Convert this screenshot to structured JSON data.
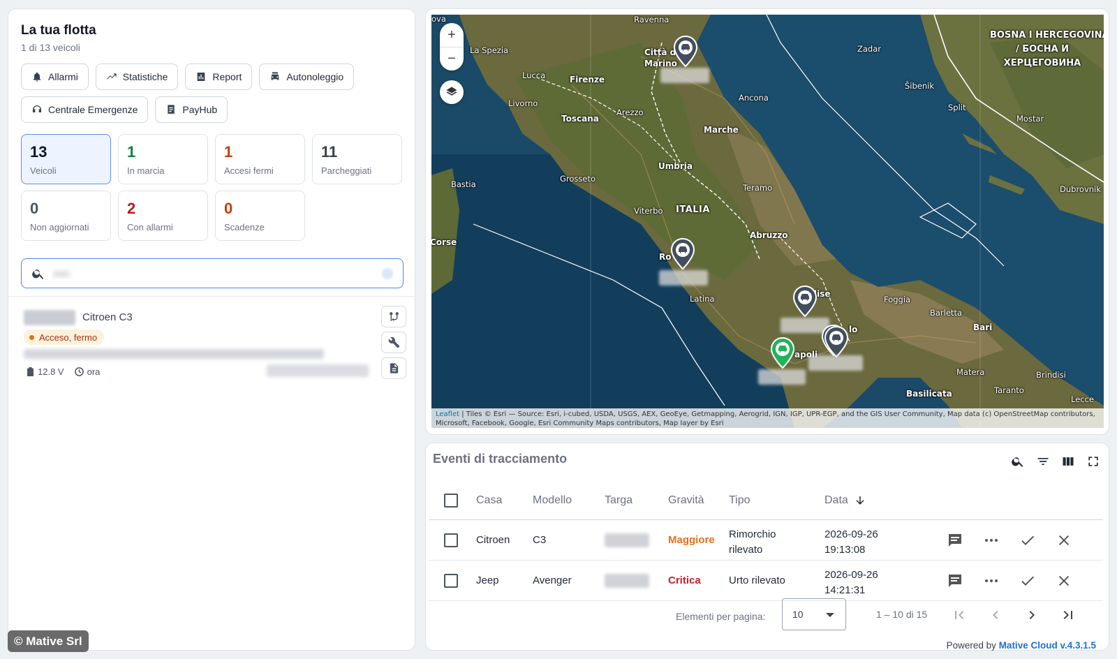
{
  "fleet": {
    "title": "La tua flotta",
    "subtitle": "1 di 13 veicoli",
    "buttons": [
      {
        "label": "Allarmi",
        "icon": "bell-icon"
      },
      {
        "label": "Statistiche",
        "icon": "trend-icon"
      },
      {
        "label": "Report",
        "icon": "report-icon"
      },
      {
        "label": "Autonoleggio",
        "icon": "car-rental-icon"
      },
      {
        "label": "Centrale Emergenze",
        "icon": "headset-icon"
      },
      {
        "label": "PayHub",
        "icon": "receipt-icon"
      }
    ],
    "stats": [
      {
        "value": "13",
        "label": "Veicoli"
      },
      {
        "value": "1",
        "label": "In marcia"
      },
      {
        "value": "1",
        "label": "Accesi fermi"
      },
      {
        "value": "11",
        "label": "Parcheggiati"
      },
      {
        "value": "0",
        "label": "Non aggiornati"
      },
      {
        "value": "2",
        "label": "Con allarmi"
      },
      {
        "value": "0",
        "label": "Scadenze"
      }
    ],
    "search": {
      "value": "•••••"
    },
    "vehicle": {
      "model": "Citroen C3",
      "status": "Acceso, fermo",
      "voltage": "12.8 V",
      "updated": "ora"
    }
  },
  "watermark": "© Mative Srl",
  "map": {
    "labels": {
      "ravenna": "Ravenna",
      "laspezia": "La Spezia",
      "lucca": "Lucca",
      "firenze": "Firenze",
      "livorno": "Livorno",
      "toscana": "Toscana",
      "arezzo": "Arezzo",
      "marche": "Marche",
      "ancona": "Ancona",
      "umbria": "Umbria",
      "grosseto": "Grosseto",
      "bastia": "Bastia",
      "teramo": "Teramo",
      "viterbo": "Viterbo",
      "italia": "ITALIA",
      "abruzzo": "Abruzzo",
      "corse": "Corse",
      "latina": "Latina",
      "foggia": "Foggia",
      "barletta": "Barletta",
      "bari": "Bari",
      "matera": "Matera",
      "brindisi": "Brindisi",
      "taranto": "Taranto",
      "basilicata": "Basilicata",
      "lecce": "Lecce",
      "zadar": "Zadar",
      "sibenik": "Šibenik",
      "split": "Split",
      "mostar": "Mostar",
      "dubrovnik": "Dubrovnik",
      "bosna1": "BOSNA I HERCEGOVINA",
      "bosna2": "/ БОСНА И",
      "bosna3": "ХЕРЦЕГОВИНА",
      "citta": "Città di",
      "marino": "Marino",
      "ova": "ova",
      "ro": "Ro",
      "lise": "lise",
      "apoli": "apoli",
      "lo": "lo"
    },
    "zoom_in": "+",
    "zoom_out": "−",
    "attribution_link": "Leaflet",
    "attribution": " | Tiles © Esri — Source: Esri, i-cubed, USDA, USGS, AEX, GeoEye, Getmapping, Aerogrid, IGN, IGP, UPR-EGP, and the GIS User Community, Map data (c) OpenStreetMap contributors, Microsoft, Facebook, Google, Esri Community Maps contributors, Map layer by Esri"
  },
  "events": {
    "title": "Eventi di tracciamento",
    "columns": [
      "Casa",
      "Modello",
      "Targa",
      "Gravità",
      "Tipo",
      "Data"
    ],
    "rows": [
      {
        "make": "Citroen",
        "model": "C3",
        "severity": "Maggiore",
        "type_l1": "Rimorchio",
        "type_l2": "rilevato",
        "date": "2026-09-26",
        "time": "19:13:08"
      },
      {
        "make": "Jeep",
        "model": "Avenger",
        "severity": "Critica",
        "type_l1": "Urto rilevato",
        "type_l2": "",
        "date": "2026-09-26",
        "time": "14:21:31"
      }
    ],
    "pager": {
      "label": "Elementi per pagina:",
      "page_size": "10",
      "range": "1 – 10 di 15"
    },
    "powered_prefix": "Powered by ",
    "powered_brand": "Mative Cloud v.4.3.1.5"
  },
  "colors": {
    "accent": "#4f86e8",
    "major": "#e8701a",
    "critical": "#c81e2a",
    "running": "#15803d"
  }
}
